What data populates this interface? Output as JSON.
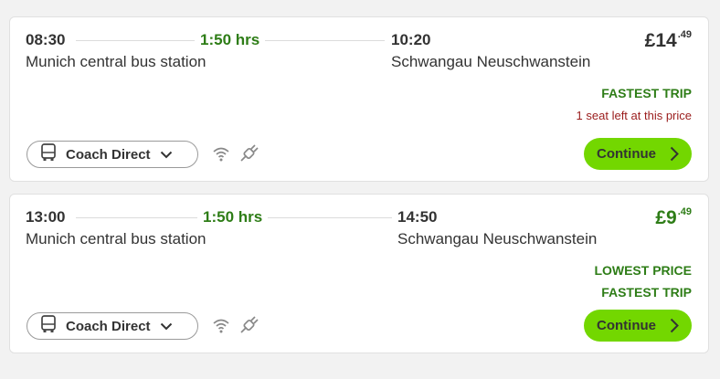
{
  "trips": [
    {
      "departure_time": "08:30",
      "departure_station": "Munich central bus station",
      "duration": "1:50 hrs",
      "arrival_time": "10:20",
      "arrival_station": "Schwangau Neuschwanstein",
      "price_main": "£14",
      "price_cents": ".49",
      "tags": [
        "FASTEST TRIP"
      ],
      "warning": "1 seat left at this price",
      "coach_type": "Coach Direct",
      "amenity_icons": [
        "wifi-icon",
        "power-plug-icon"
      ],
      "continue_label": "Continue"
    },
    {
      "departure_time": "13:00",
      "departure_station": "Munich central bus station",
      "duration": "1:50 hrs",
      "arrival_time": "14:50",
      "arrival_station": "Schwangau Neuschwanstein",
      "price_main": "£9",
      "price_cents": ".49",
      "tags": [
        "LOWEST PRICE",
        "FASTEST TRIP"
      ],
      "coach_type": "Coach Direct",
      "amenity_icons": [
        "wifi-icon",
        "power-plug-icon"
      ],
      "continue_label": "Continue"
    }
  ],
  "colors": {
    "accent_green": "#73d700",
    "tag_green": "#2e7d17",
    "warning_red": "#9a1c1c",
    "background": "#f2f2f2"
  }
}
